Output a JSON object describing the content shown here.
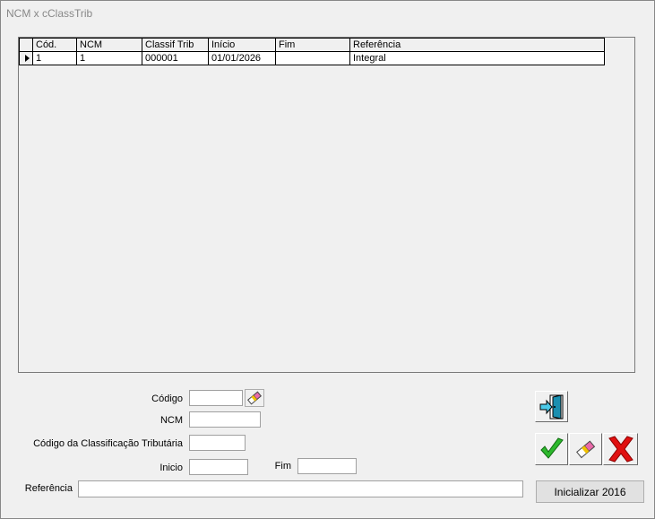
{
  "window": {
    "title": "NCM x cClassTrib"
  },
  "grid": {
    "columns": [
      "Cód.",
      "NCM",
      "Classif Trib",
      "Início",
      "Fim",
      "Referência"
    ],
    "rows": [
      {
        "cod": "1",
        "ncm": "1",
        "classif": "000001",
        "inicio": "01/01/2026",
        "fim": "",
        "referencia": "Integral"
      }
    ]
  },
  "form": {
    "codigo_label": "Código",
    "codigo_value": "",
    "ncm_label": "NCM",
    "ncm_value": "",
    "classif_label": "Código da Classificação Tributária",
    "classif_value": "",
    "inicio_label": "Inicio",
    "inicio_value": "",
    "fim_label": "Fim",
    "fim_value": "",
    "referencia_label": "Referência",
    "referencia_value": ""
  },
  "buttons": {
    "inicializar_label": "Inicializar 2016",
    "exit_icon": "exit-door-icon",
    "confirm_icon": "green-check-icon",
    "clear_icon": "eraser-icon",
    "cancel_icon": "red-x-icon"
  },
  "colors": {
    "confirm": "#2db82d",
    "cancel": "#e01010",
    "exit_door": "#1a8fb0"
  }
}
